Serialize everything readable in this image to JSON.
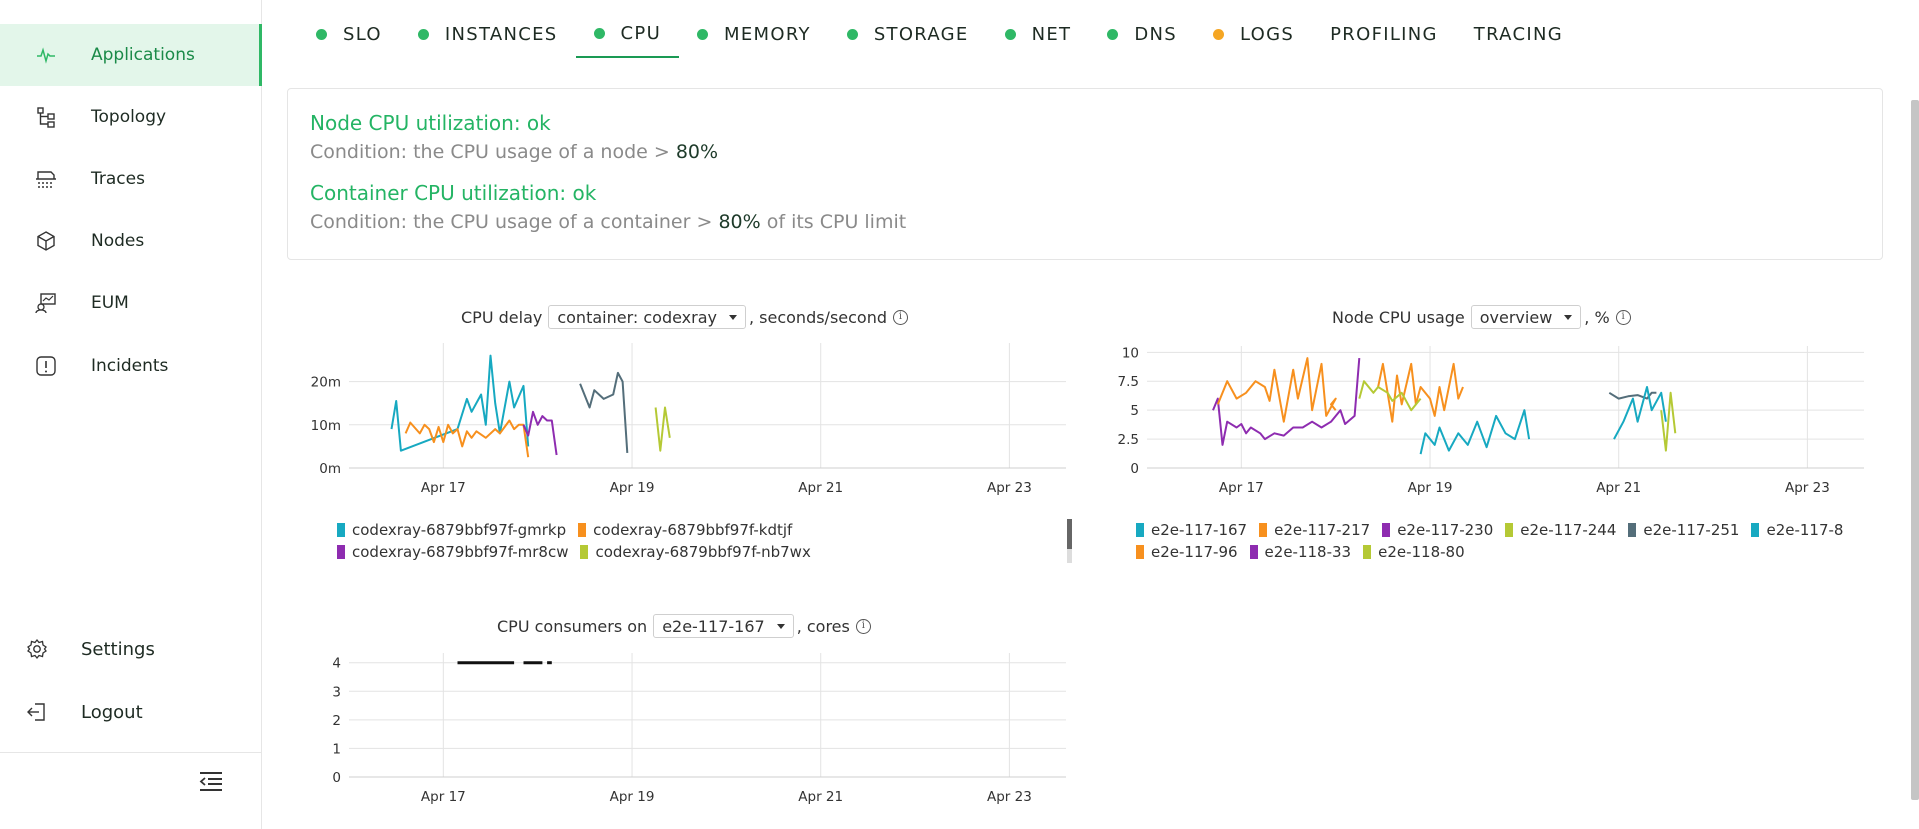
{
  "sidebar": {
    "items": [
      {
        "label": "Applications",
        "icon": "pulse-icon"
      },
      {
        "label": "Topology",
        "icon": "topology-icon"
      },
      {
        "label": "Traces",
        "icon": "traces-icon"
      },
      {
        "label": "Nodes",
        "icon": "cube-icon"
      },
      {
        "label": "EUM",
        "icon": "eum-icon"
      },
      {
        "label": "Incidents",
        "icon": "alert-icon"
      }
    ],
    "settings_label": "Settings",
    "logout_label": "Logout"
  },
  "tabs": [
    {
      "label": "SLO",
      "status": "#2fb866"
    },
    {
      "label": "INSTANCES",
      "status": "#2fb866"
    },
    {
      "label": "CPU",
      "status": "#2fb866",
      "active": true
    },
    {
      "label": "MEMORY",
      "status": "#2fb866"
    },
    {
      "label": "STORAGE",
      "status": "#2fb866"
    },
    {
      "label": "NET",
      "status": "#2fb866"
    },
    {
      "label": "DNS",
      "status": "#2fb866"
    },
    {
      "label": "LOGS",
      "status": "#f5a623"
    },
    {
      "label": "PROFILING",
      "status": ""
    },
    {
      "label": "TRACING",
      "status": ""
    }
  ],
  "checks": [
    {
      "title": "Node CPU utilization: ok",
      "cond_prefix": "Condition: the CPU usage of a node > ",
      "value": "80%",
      "cond_suffix": ""
    },
    {
      "title": "Container CPU utilization: ok",
      "cond_prefix": "Condition: the CPU usage of a container > ",
      "value": "80%",
      "cond_suffix": " of its CPU limit"
    }
  ],
  "charts": {
    "delay": {
      "title_prefix": "CPU delay",
      "selector": "container: codexray",
      "title_suffix": ", seconds/second"
    },
    "node": {
      "title_prefix": "Node CPU usage",
      "selector": "overview",
      "title_suffix": ", %"
    },
    "consumers": {
      "title_prefix": "CPU consumers on",
      "selector": "e2e-117-167",
      "title_suffix": ", cores"
    }
  },
  "chart_data": [
    {
      "type": "line",
      "x_ticks": [
        "Apr 17",
        "Apr 19",
        "Apr 21",
        "Apr 23"
      ],
      "y_ticks": [
        "0m",
        "10m",
        "20m"
      ],
      "ylim": [
        0,
        28
      ],
      "series": [
        {
          "name": "codexray-6879bbf97f-gmrkp",
          "color": "#17a9c1",
          "points": [
            [
              16.45,
              9
            ],
            [
              16.5,
              15.5
            ],
            [
              16.55,
              4
            ],
            [
              17.15,
              9
            ],
            [
              17.25,
              16
            ],
            [
              17.3,
              13
            ],
            [
              17.4,
              17
            ],
            [
              17.45,
              10
            ],
            [
              17.5,
              26
            ],
            [
              17.55,
              15
            ],
            [
              17.6,
              8
            ],
            [
              17.7,
              20
            ],
            [
              17.75,
              14
            ],
            [
              17.85,
              19
            ],
            [
              17.9,
              5
            ]
          ]
        },
        {
          "name": "codexray-6879bbf97f-kdtjf",
          "color": "#f7901e",
          "points": [
            [
              16.6,
              8
            ],
            [
              16.65,
              10.5
            ],
            [
              16.75,
              8
            ],
            [
              16.8,
              10
            ],
            [
              16.85,
              9
            ],
            [
              16.9,
              6
            ],
            [
              16.95,
              9.5
            ],
            [
              17.0,
              6
            ],
            [
              17.05,
              10
            ],
            [
              17.1,
              8
            ],
            [
              17.15,
              9
            ],
            [
              17.2,
              5
            ],
            [
              17.25,
              8.5
            ],
            [
              17.3,
              7
            ],
            [
              17.35,
              8.5
            ],
            [
              17.45,
              7
            ],
            [
              17.55,
              9
            ],
            [
              17.6,
              8
            ],
            [
              17.7,
              11
            ],
            [
              17.75,
              9
            ],
            [
              17.8,
              10
            ],
            [
              17.85,
              10
            ],
            [
              17.9,
              2.5
            ]
          ]
        },
        {
          "name": "codexray-6879bbf97f-mr8cw",
          "color": "#8e2cb0",
          "points": [
            [
              17.85,
              10
            ],
            [
              17.9,
              7.5
            ],
            [
              17.95,
              13
            ],
            [
              18.0,
              10
            ],
            [
              18.05,
              12
            ],
            [
              18.1,
              11
            ],
            [
              18.15,
              11
            ],
            [
              18.2,
              3
            ]
          ]
        },
        {
          "name": "codexray-6879bbf97f-nb7wx",
          "color": "#b5c935",
          "points": [
            [
              19.25,
              14
            ],
            [
              19.3,
              4
            ],
            [
              19.35,
              14
            ],
            [
              19.4,
              7
            ]
          ]
        },
        {
          "name": "",
          "color": "#546e7a",
          "points": [
            [
              18.45,
              19.5
            ],
            [
              18.55,
              14
            ],
            [
              18.6,
              18
            ],
            [
              18.7,
              16
            ],
            [
              18.8,
              17
            ],
            [
              18.85,
              22
            ],
            [
              18.9,
              20
            ],
            [
              18.95,
              3.5
            ]
          ]
        }
      ]
    },
    {
      "type": "line",
      "x_ticks": [
        "Apr 17",
        "Apr 19",
        "Apr 21",
        "Apr 23"
      ],
      "y_ticks": [
        "0",
        "2.5",
        "5",
        "7.5",
        "10"
      ],
      "ylim": [
        0,
        10.2
      ],
      "series": [
        {
          "name": "e2e-117-167",
          "color": "#17a9c1"
        },
        {
          "name": "e2e-117-217",
          "color": "#f7901e"
        },
        {
          "name": "e2e-117-230",
          "color": "#8e2cb0"
        },
        {
          "name": "e2e-117-244",
          "color": "#b5c935"
        },
        {
          "name": "e2e-117-251",
          "color": "#546e7a"
        },
        {
          "name": "e2e-117-8",
          "color": "#17a9c1"
        },
        {
          "name": "e2e-117-96",
          "color": "#f7901e"
        },
        {
          "name": "e2e-118-33",
          "color": "#8e2cb0"
        },
        {
          "name": "e2e-118-80",
          "color": "#b5c935"
        }
      ]
    },
    {
      "type": "line",
      "x_ticks": [
        "Apr 17",
        "Apr 19",
        "Apr 21",
        "Apr 23"
      ],
      "y_ticks": [
        "0",
        "1",
        "2",
        "3",
        "4"
      ],
      "ylim": [
        0,
        4.2
      ],
      "series": [
        {
          "name": "",
          "color": "#111111",
          "points": [
            [
              17.15,
              4
            ],
            [
              17.75,
              4
            ]
          ]
        },
        {
          "name": "",
          "color": "#111111",
          "points": [
            [
              17.85,
              4
            ],
            [
              18.05,
              4
            ]
          ]
        },
        {
          "name": "",
          "color": "#111111",
          "points": [
            [
              18.1,
              4
            ],
            [
              18.15,
              4
            ]
          ]
        }
      ]
    }
  ]
}
